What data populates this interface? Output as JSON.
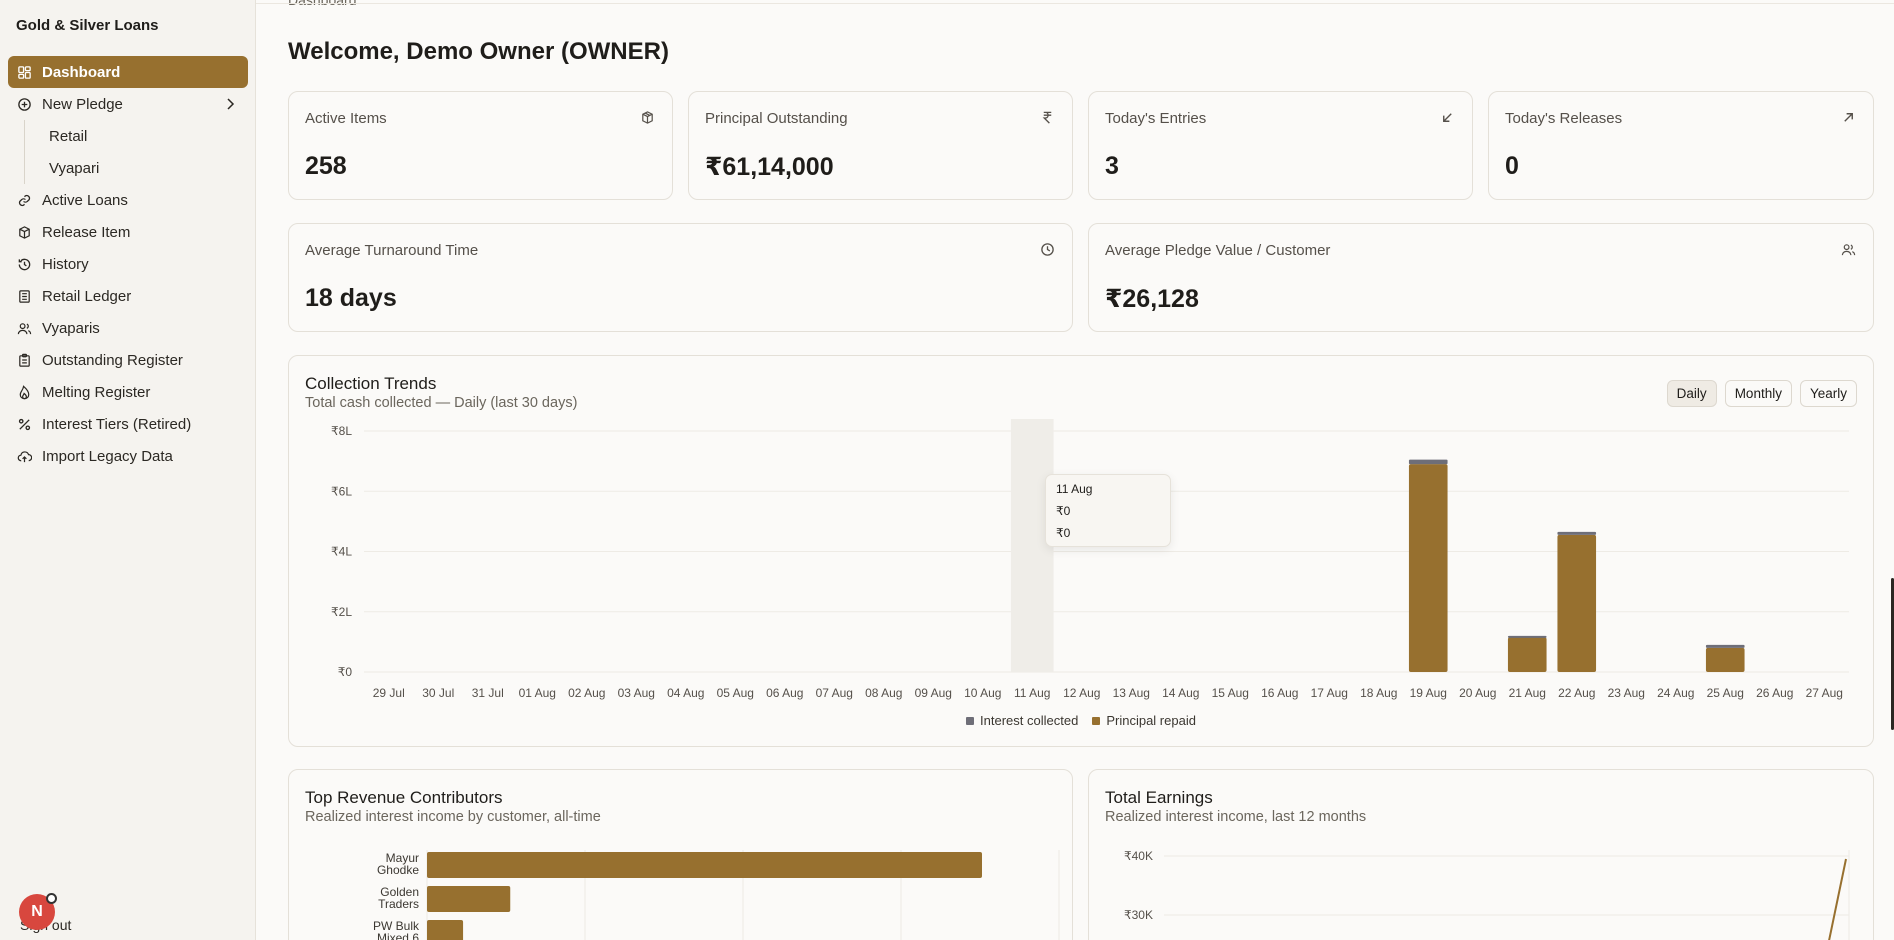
{
  "app": {
    "brand": "Gold & Silver Loans"
  },
  "sidebar": {
    "items": [
      {
        "label": "Dashboard",
        "icon": "dashboard-grid-icon",
        "active": true
      },
      {
        "label": "New Pledge",
        "icon": "plus-circle-icon"
      },
      {
        "label": "Retail"
      },
      {
        "label": "Vyapari"
      },
      {
        "label": "Active Loans",
        "icon": "link-icon"
      },
      {
        "label": "Release Item",
        "icon": "package-icon"
      },
      {
        "label": "History",
        "icon": "history-icon"
      },
      {
        "label": "Retail Ledger",
        "icon": "ledger-icon"
      },
      {
        "label": "Vyaparis",
        "icon": "users-icon"
      },
      {
        "label": "Outstanding Register",
        "icon": "clipboard-icon"
      },
      {
        "label": "Melting Register",
        "icon": "flame-icon"
      },
      {
        "label": "Interest Tiers (Retired)",
        "icon": "percent-icon"
      },
      {
        "label": "Import Legacy Data",
        "icon": "cloud-upload-icon"
      }
    ],
    "avatar_initial": "N",
    "signout": "Sign out"
  },
  "header": {
    "breadcrumb": "Dashboard",
    "title": "Welcome, Demo Owner (OWNER)"
  },
  "stats": [
    {
      "label": "Active Items",
      "value": "258",
      "icon": "box-icon"
    },
    {
      "label": "Principal Outstanding",
      "value": "₹61,14,000",
      "icon": "rupee-icon"
    },
    {
      "label": "Today's Entries",
      "value": "3",
      "icon": "arrow-down-left-icon"
    },
    {
      "label": "Today's Releases",
      "value": "0",
      "icon": "arrow-up-right-icon"
    },
    {
      "label": "Average Turnaround Time",
      "value": "18 days",
      "icon": "clock-icon"
    },
    {
      "label": "Average Pledge Value / Customer",
      "value": "₹26,128",
      "icon": "users-icon"
    }
  ],
  "collection": {
    "title": "Collection Trends",
    "subtitle": "Total cash collected — Daily (last 30 days)",
    "buttons": [
      "Daily",
      "Monthly",
      "Yearly"
    ],
    "selected": "Daily",
    "tooltip": {
      "date": "11 Aug",
      "line1": "₹0",
      "line2": "₹0"
    }
  },
  "top_revenue": {
    "title": "Top Revenue Contributors",
    "subtitle": "Realized interest income by customer, all-time"
  },
  "earnings": {
    "title": "Total Earnings",
    "subtitle": "Realized interest income, last 12 months"
  },
  "colors": {
    "accent": "#97702f",
    "interest": "#6e6e78",
    "principal": "#97702f"
  },
  "chart_data": [
    {
      "type": "bar",
      "stacked": true,
      "categories": [
        "29 Jul",
        "30 Jul",
        "31 Jul",
        "01 Aug",
        "02 Aug",
        "03 Aug",
        "04 Aug",
        "05 Aug",
        "06 Aug",
        "07 Aug",
        "08 Aug",
        "09 Aug",
        "10 Aug",
        "11 Aug",
        "12 Aug",
        "13 Aug",
        "14 Aug",
        "15 Aug",
        "16 Aug",
        "17 Aug",
        "18 Aug",
        "19 Aug",
        "20 Aug",
        "21 Aug",
        "22 Aug",
        "23 Aug",
        "24 Aug",
        "25 Aug",
        "26 Aug",
        "27 Aug"
      ],
      "series": [
        {
          "name": "Interest collected",
          "values": [
            0,
            0,
            0,
            0,
            0,
            0,
            0,
            0,
            0,
            0,
            0,
            0,
            0,
            0,
            0,
            0,
            0,
            0,
            0,
            0,
            0,
            15000,
            0,
            5000,
            10000,
            0,
            0,
            10000,
            0,
            0
          ]
        },
        {
          "name": "Principal repaid",
          "values": [
            0,
            0,
            0,
            0,
            0,
            0,
            0,
            0,
            0,
            0,
            0,
            0,
            0,
            0,
            0,
            0,
            0,
            0,
            0,
            0,
            0,
            690000,
            0,
            115000,
            455000,
            0,
            0,
            80000,
            0,
            0
          ]
        }
      ],
      "yticks": [
        "₹0",
        "₹2L",
        "₹4L",
        "₹6L",
        "₹8L"
      ],
      "ylim": [
        0,
        800000
      ],
      "highlight": "11 Aug",
      "legend": "bottom"
    },
    {
      "type": "bar",
      "orientation": "horizontal",
      "categories": [
        "Mayur Ghodke",
        "Golden Traders",
        "PW Bulk Mixed 6"
      ],
      "values": [
        100,
        15,
        6.5
      ]
    },
    {
      "type": "line",
      "yticks": [
        "₹40K",
        "₹30K"
      ],
      "ylim": [
        0,
        40000
      ]
    }
  ]
}
